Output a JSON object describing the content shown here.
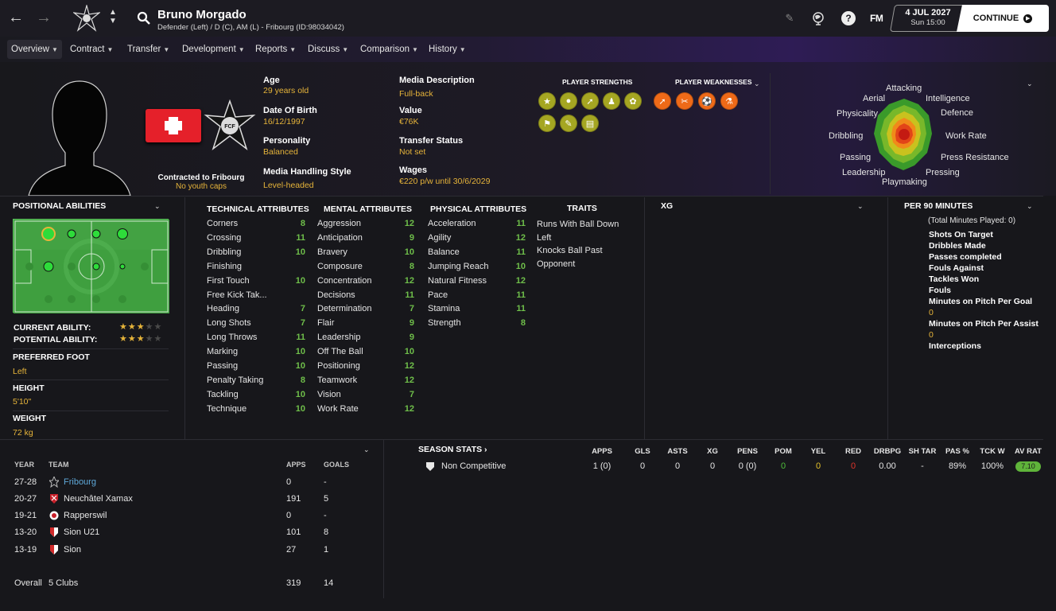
{
  "player": {
    "name": "Bruno Morgado",
    "subtitle": "Defender (Left) / D (C), AM (L) - Fribourg (ID:98034042)"
  },
  "topbar": {
    "date": "4 JUL 2027",
    "time": "Sun 15:00",
    "continue_label": "CONTINUE",
    "fm_logo": "FM"
  },
  "menu": [
    "Overview",
    "Contract",
    "Transfer",
    "Development",
    "Reports",
    "Discuss",
    "Comparison",
    "History"
  ],
  "profile": {
    "contracted": "Contracted to Fribourg",
    "youth_caps": "No youth caps",
    "crest_text": "FCF",
    "age_label": "Age",
    "age": "29 years old",
    "dob_label": "Date Of Birth",
    "dob": "16/12/1997",
    "personality_label": "Personality",
    "personality": "Balanced",
    "media_handling_label": "Media Handling Style",
    "media_handling": "Level-headed",
    "media_desc_label": "Media Description",
    "media_desc": "Full-back",
    "value_label": "Value",
    "value": "€76K",
    "transfer_status_label": "Transfer Status",
    "transfer_status": "Not set",
    "wages_label": "Wages",
    "wages": "€220 p/w until 30/6/2029"
  },
  "strengths": {
    "title": "PLAYER STRENGTHS",
    "icons": [
      "star-icon",
      "head-icon",
      "tackle-icon",
      "trophy-icon",
      "boots-icon",
      "flag-icon",
      "clipboard-icon",
      "id-card-icon"
    ]
  },
  "weaknesses": {
    "title": "PLAYER WEAKNESSES",
    "icons": [
      "trend-icon",
      "scissors-icon",
      "ball-icon",
      "flask-icon"
    ]
  },
  "radar": {
    "labels": [
      "Attacking",
      "Intelligence",
      "Defence",
      "Work Rate",
      "Press Resistance",
      "Pressing",
      "Playmaking",
      "Leadership",
      "Passing",
      "Dribbling",
      "Physicality",
      "Aerial"
    ]
  },
  "positional": {
    "title": "POSITIONAL ABILITIES",
    "current_ability_label": "CURRENT ABILITY:",
    "potential_ability_label": "POTENTIAL ABILITY:",
    "current_stars": 3,
    "potential_stars": 3,
    "preferred_foot_label": "PREFERRED FOOT",
    "preferred_foot": "Left",
    "height_label": "HEIGHT",
    "height": "5'10\"",
    "weight_label": "WEIGHT",
    "weight": "72 kg"
  },
  "technical": {
    "title": "TECHNICAL ATTRIBUTES",
    "rows": [
      {
        "name": "Corners",
        "value": "8"
      },
      {
        "name": "Crossing",
        "value": "11"
      },
      {
        "name": "Dribbling",
        "value": "10"
      },
      {
        "name": "Finishing",
        "value": ""
      },
      {
        "name": "First Touch",
        "value": "10"
      },
      {
        "name": "Free Kick Tak...",
        "value": ""
      },
      {
        "name": "Heading",
        "value": "7"
      },
      {
        "name": "Long Shots",
        "value": "7"
      },
      {
        "name": "Long Throws",
        "value": "11"
      },
      {
        "name": "Marking",
        "value": "10"
      },
      {
        "name": "Passing",
        "value": "10"
      },
      {
        "name": "Penalty Taking",
        "value": "8"
      },
      {
        "name": "Tackling",
        "value": "10"
      },
      {
        "name": "Technique",
        "value": "10"
      }
    ]
  },
  "mental": {
    "title": "MENTAL ATTRIBUTES",
    "rows": [
      {
        "name": "Aggression",
        "value": "12"
      },
      {
        "name": "Anticipation",
        "value": "9"
      },
      {
        "name": "Bravery",
        "value": "10"
      },
      {
        "name": "Composure",
        "value": "8"
      },
      {
        "name": "Concentration",
        "value": "12"
      },
      {
        "name": "Decisions",
        "value": "11"
      },
      {
        "name": "Determination",
        "value": "7"
      },
      {
        "name": "Flair",
        "value": "9"
      },
      {
        "name": "Leadership",
        "value": "9"
      },
      {
        "name": "Off The Ball",
        "value": "10"
      },
      {
        "name": "Positioning",
        "value": "12"
      },
      {
        "name": "Teamwork",
        "value": "12"
      },
      {
        "name": "Vision",
        "value": "7"
      },
      {
        "name": "Work Rate",
        "value": "12"
      }
    ]
  },
  "physical": {
    "title": "PHYSICAL ATTRIBUTES",
    "rows": [
      {
        "name": "Acceleration",
        "value": "11"
      },
      {
        "name": "Agility",
        "value": "12"
      },
      {
        "name": "Balance",
        "value": "11"
      },
      {
        "name": "Jumping Reach",
        "value": "10"
      },
      {
        "name": "Natural Fitness",
        "value": "12"
      },
      {
        "name": "Pace",
        "value": "11"
      },
      {
        "name": "Stamina",
        "value": "11"
      },
      {
        "name": "Strength",
        "value": "8"
      }
    ]
  },
  "traits": {
    "title": "TRAITS",
    "items": [
      "Runs With Ball Down Left",
      "Knocks Ball Past Opponent"
    ]
  },
  "xg": {
    "title": "XG"
  },
  "per90": {
    "title": "PER 90 MINUTES",
    "total_minutes": "(Total Minutes Played: 0)",
    "stats": [
      "Shots On Target",
      "Dribbles Made",
      "Passes completed",
      "Fouls Against",
      "Tackles Won",
      "Fouls",
      "Minutes on Pitch Per Goal",
      "Minutes on Pitch Per Assist",
      "Interceptions"
    ],
    "goal_value": "0",
    "assist_value": "0"
  },
  "history": {
    "headers": {
      "year": "YEAR",
      "team": "TEAM",
      "apps": "APPS",
      "goals": "GOALS"
    },
    "rows": [
      {
        "year": "27-28",
        "team": "Fribourg",
        "apps": "0",
        "goals": "-"
      },
      {
        "year": "20-27",
        "team": "Neuchâtel Xamax",
        "apps": "191",
        "goals": "5"
      },
      {
        "year": "19-21",
        "team": "Rapperswil",
        "apps": "0",
        "goals": "-"
      },
      {
        "year": "13-20",
        "team": "Sion U21",
        "apps": "101",
        "goals": "8"
      },
      {
        "year": "13-19",
        "team": "Sion",
        "apps": "27",
        "goals": "1"
      }
    ],
    "overall": {
      "label": "Overall",
      "clubs": "5 Clubs",
      "apps": "319",
      "goals": "14"
    }
  },
  "season_stats": {
    "title": "SEASON STATS",
    "headers": [
      "APPS",
      "GLS",
      "ASTS",
      "XG",
      "PENS",
      "POM",
      "YEL",
      "RED",
      "DRBPG",
      "SH TAR",
      "PAS %",
      "TCK W",
      "AV RAT"
    ],
    "competition": "Non Competitive",
    "values": [
      "1 (0)",
      "0",
      "0",
      "0",
      "0 (0)",
      "0",
      "0",
      "0",
      "0.00",
      "-",
      "89%",
      "100%",
      "7.10"
    ]
  },
  "colors": {
    "accent_gold": "#e6b43a",
    "attr_green": "#6fbf4a",
    "strength_badge": "#a5a622",
    "weakness_badge": "#ee6a18"
  }
}
